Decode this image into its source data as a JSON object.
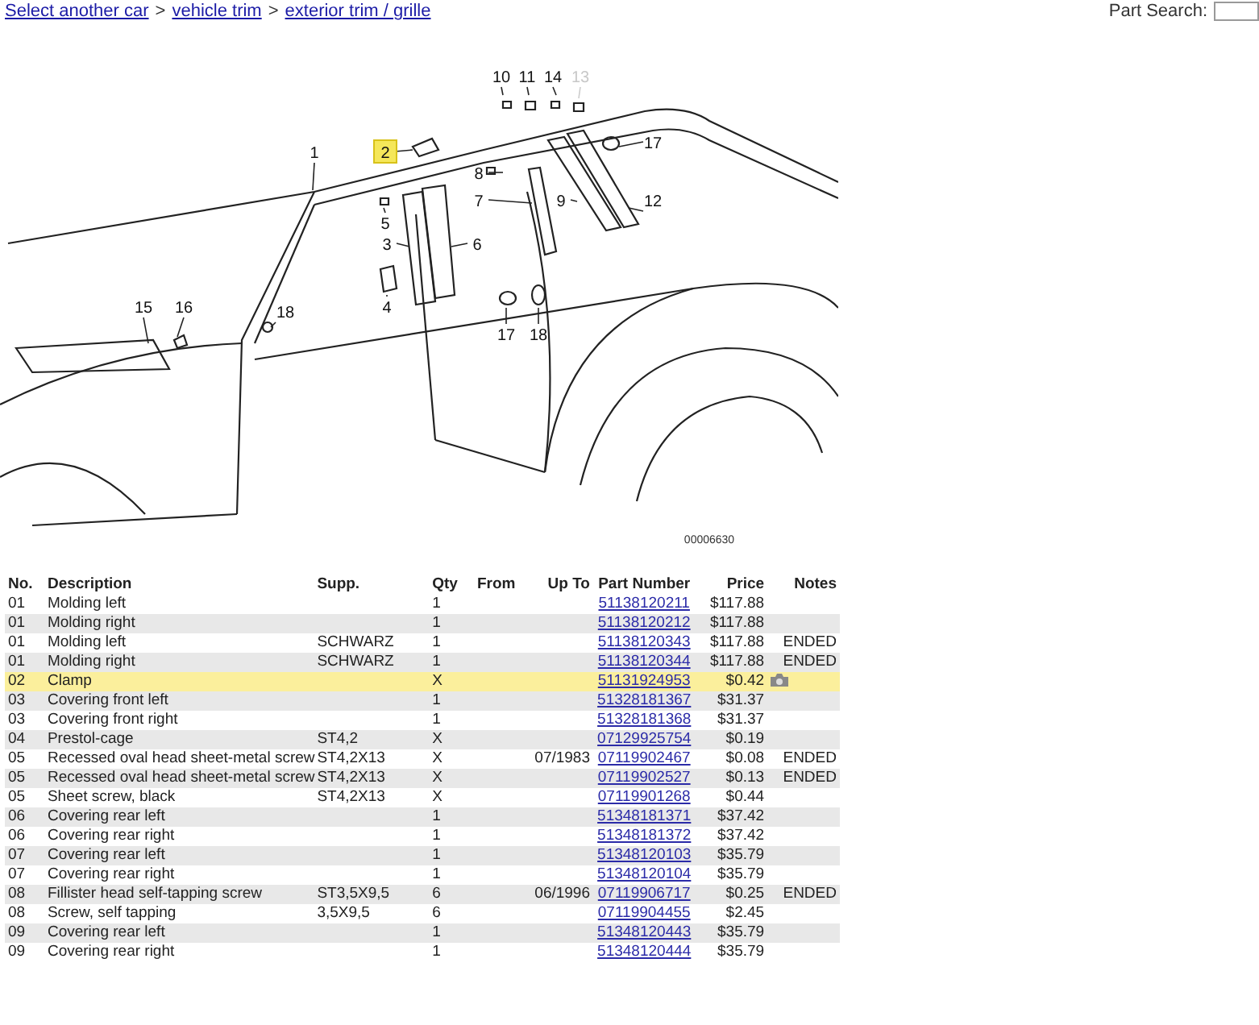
{
  "breadcrumb": [
    "Select another car",
    "vehicle trim",
    "exterior trim / grille"
  ],
  "breadcrumb_separator": ">",
  "part_search": {
    "label": "Part Search:"
  },
  "diagram": {
    "image_number": "00006630",
    "callouts": [
      {
        "label": "10",
        "selected": false,
        "dimmed": false
      },
      {
        "label": "11",
        "selected": false,
        "dimmed": false
      },
      {
        "label": "14",
        "selected": false,
        "dimmed": false
      },
      {
        "label": "13",
        "selected": false,
        "dimmed": true
      },
      {
        "label": "2",
        "selected": true,
        "dimmed": false
      },
      {
        "label": "17",
        "selected": false,
        "dimmed": false
      },
      {
        "label": "1",
        "selected": false,
        "dimmed": false
      },
      {
        "label": "8",
        "selected": false,
        "dimmed": false
      },
      {
        "label": "7",
        "selected": false,
        "dimmed": false
      },
      {
        "label": "9",
        "selected": false,
        "dimmed": false
      },
      {
        "label": "12",
        "selected": false,
        "dimmed": false
      },
      {
        "label": "5",
        "selected": false,
        "dimmed": false
      },
      {
        "label": "3",
        "selected": false,
        "dimmed": false
      },
      {
        "label": "6",
        "selected": false,
        "dimmed": false
      },
      {
        "label": "15",
        "selected": false,
        "dimmed": false
      },
      {
        "label": "16",
        "selected": false,
        "dimmed": false
      },
      {
        "label": "18",
        "selected": false,
        "dimmed": false
      },
      {
        "label": "4",
        "selected": false,
        "dimmed": false
      },
      {
        "label": "17",
        "selected": false,
        "dimmed": false
      },
      {
        "label": "18",
        "selected": false,
        "dimmed": false
      }
    ]
  },
  "table": {
    "columns": [
      "No.",
      "Description",
      "Supp.",
      "Qty",
      "From",
      "Up To",
      "Part Number",
      "Price",
      "Notes"
    ],
    "rows": [
      {
        "no": "01",
        "description": "Molding left",
        "qty": "1",
        "part_number": "51138120211",
        "price": "$117.88",
        "selected": false,
        "has_photo": false
      },
      {
        "no": "01",
        "description": "Molding right",
        "qty": "1",
        "part_number": "51138120212",
        "price": "$117.88",
        "selected": false,
        "has_photo": false
      },
      {
        "no": "01",
        "description": "Molding left",
        "supp": "SCHWARZ",
        "qty": "1",
        "part_number": "51138120343",
        "price": "$117.88",
        "notes": "ENDED",
        "selected": false,
        "has_photo": false
      },
      {
        "no": "01",
        "description": "Molding right",
        "supp": "SCHWARZ",
        "qty": "1",
        "part_number": "51138120344",
        "price": "$117.88",
        "notes": "ENDED",
        "selected": false,
        "has_photo": false
      },
      {
        "no": "02",
        "description": "Clamp",
        "qty": "X",
        "part_number": "51131924953",
        "price": "$0.42",
        "selected": true,
        "has_photo": true
      },
      {
        "no": "03",
        "description": "Covering front left",
        "qty": "1",
        "part_number": "51328181367",
        "price": "$31.37",
        "selected": false,
        "has_photo": false
      },
      {
        "no": "03",
        "description": "Covering front right",
        "qty": "1",
        "part_number": "51328181368",
        "price": "$31.37",
        "selected": false,
        "has_photo": false
      },
      {
        "no": "04",
        "description": "Prestol-cage",
        "supp": "ST4,2",
        "qty": "X",
        "part_number": "07129925754",
        "price": "$0.19",
        "selected": false,
        "has_photo": false
      },
      {
        "no": "05",
        "description": "Recessed oval head sheet-metal screw",
        "supp": "ST4,2X13",
        "qty": "X",
        "up_to": "07/1983",
        "part_number": "07119902467",
        "price": "$0.08",
        "notes": "ENDED",
        "selected": false,
        "has_photo": false
      },
      {
        "no": "05",
        "description": "Recessed oval head sheet-metal screw",
        "supp": "ST4,2X13",
        "qty": "X",
        "part_number": "07119902527",
        "price": "$0.13",
        "notes": "ENDED",
        "selected": false,
        "has_photo": false
      },
      {
        "no": "05",
        "description": "Sheet screw, black",
        "supp": "ST4,2X13",
        "qty": "X",
        "part_number": "07119901268",
        "price": "$0.44",
        "selected": false,
        "has_photo": false
      },
      {
        "no": "06",
        "description": "Covering rear left",
        "qty": "1",
        "part_number": "51348181371",
        "price": "$37.42",
        "selected": false,
        "has_photo": false
      },
      {
        "no": "06",
        "description": "Covering rear right",
        "qty": "1",
        "part_number": "51348181372",
        "price": "$37.42",
        "selected": false,
        "has_photo": false
      },
      {
        "no": "07",
        "description": "Covering rear left",
        "qty": "1",
        "part_number": "51348120103",
        "price": "$35.79",
        "selected": false,
        "has_photo": false
      },
      {
        "no": "07",
        "description": "Covering rear right",
        "qty": "1",
        "part_number": "51348120104",
        "price": "$35.79",
        "selected": false,
        "has_photo": false
      },
      {
        "no": "08",
        "description": "Fillister head self-tapping screw",
        "supp": "ST3,5X9,5",
        "qty": "6",
        "up_to": "06/1996",
        "part_number": "07119906717",
        "price": "$0.25",
        "notes": "ENDED",
        "selected": false,
        "has_photo": false
      },
      {
        "no": "08",
        "description": "Screw, self tapping",
        "supp": "3,5X9,5",
        "qty": "6",
        "part_number": "07119904455",
        "price": "$2.45",
        "selected": false,
        "has_photo": false
      },
      {
        "no": "09",
        "description": "Covering rear left",
        "qty": "1",
        "part_number": "51348120443",
        "price": "$35.79",
        "selected": false,
        "has_photo": false
      },
      {
        "no": "09",
        "description": "Covering rear right",
        "qty": "1",
        "part_number": "51348120444",
        "price": "$35.79",
        "selected": false,
        "has_photo": false
      }
    ]
  }
}
